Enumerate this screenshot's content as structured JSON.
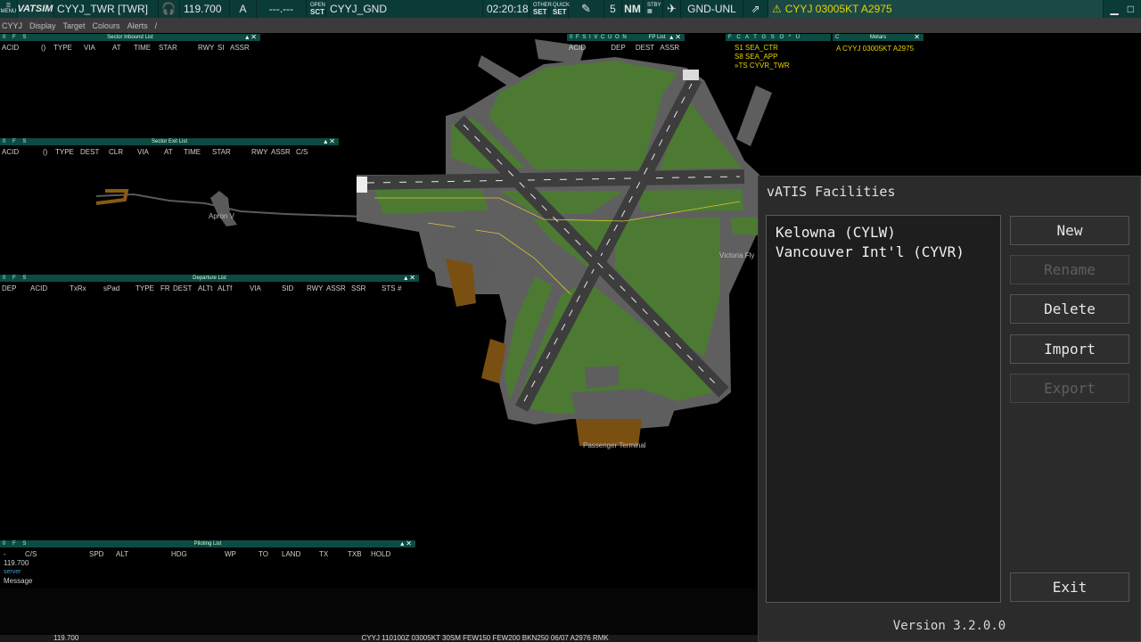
{
  "topbar": {
    "menu_label": "MENU",
    "logo": "VATSIM",
    "position": "CYYJ_TWR [TWR]",
    "frequency": "119.700",
    "atis_letter": "A",
    "dashes": "---.---",
    "open_label": "OPEN",
    "sct_label": "SCT",
    "sector": "CYYJ_GND",
    "time": "02:20:18",
    "other_label": "OTHER",
    "set_label_1": "SET",
    "quick_label": "QUICK",
    "set_label_2": "SET",
    "count": "5",
    "nm": "NM",
    "stby_label": "STBY",
    "altitude_filter": "GND-UNL",
    "metar": "CYYJ 03005KT A2975"
  },
  "menubar": {
    "items": [
      "CYYJ",
      "Display",
      "Target",
      "Colours",
      "Alerts",
      "/"
    ]
  },
  "windows": {
    "inbound": {
      "flags": "0 F S",
      "title": "Sector Inbound List",
      "columns": [
        "ACID",
        "()",
        "TYPE",
        "VIA",
        "AT",
        "TIME",
        "STAR",
        "RWY",
        "SI",
        "ASSR"
      ]
    },
    "exit": {
      "flags": "0 F S",
      "title": "Sector Exit List",
      "columns": [
        "ACID",
        "()",
        "TYPE",
        "DEST",
        "CLR",
        "VIA",
        "AT",
        "TIME",
        "STAR",
        "RWY",
        "ASSR",
        "C/S"
      ]
    },
    "departure": {
      "flags": "0 F S",
      "title": "Departure List",
      "columns": [
        "DEP",
        "ACID",
        "TxRx",
        "sPad",
        "TYPE",
        "FR",
        "DEST",
        "ALTt",
        "ALTf",
        "VIA",
        "SID",
        "RWY",
        "ASSR",
        "SSR",
        "STS",
        "#"
      ]
    },
    "piloting": {
      "flags": "0 F S",
      "title": "Piloting List",
      "columns": [
        "C/S",
        "SPD",
        "ALT",
        "HDG",
        "WP",
        "TO",
        "LAND",
        "TX",
        "TXB",
        "HOLD"
      ],
      "freq": "119.700",
      "server": "server",
      "message": "Message"
    },
    "fp": {
      "flags": "0 F S I V C U O N",
      "title": "FP List",
      "columns": [
        "ACID",
        "DEP",
        "DEST",
        "ASSR"
      ]
    },
    "controllers": {
      "flags": "F C A T G S O * U",
      "rows": [
        "S1  SEA_CTR",
        "S8  SEA_APP",
        "»TS  CYVR_TWR"
      ]
    },
    "metars": {
      "flags": "C",
      "title": "Metars",
      "row": "A CYYJ 03005KT A2975"
    }
  },
  "map_labels": {
    "apron": "Apron V",
    "terminal": "Passenger Terminal",
    "victoria": "Victoria Fly"
  },
  "vatis": {
    "title": "vATIS Facilities",
    "facilities": [
      "Kelowna (CYLW)",
      "Vancouver Int'l (CYVR)"
    ],
    "buttons": {
      "new": "New",
      "rename": "Rename",
      "delete": "Delete",
      "import": "Import",
      "export": "Export",
      "exit": "Exit"
    },
    "version": "Version 3.2.0.0"
  },
  "bottombar": {
    "freq": "119.700",
    "metar_text": "CYYJ 110100Z 03005KT 30SM FEW150 FEW200 BKN250 06/07 A2976 RMK"
  },
  "colors": {
    "grass": "#4d7a33",
    "window_teal": "#0d4a43",
    "metar_yellow": "#e6d200"
  }
}
